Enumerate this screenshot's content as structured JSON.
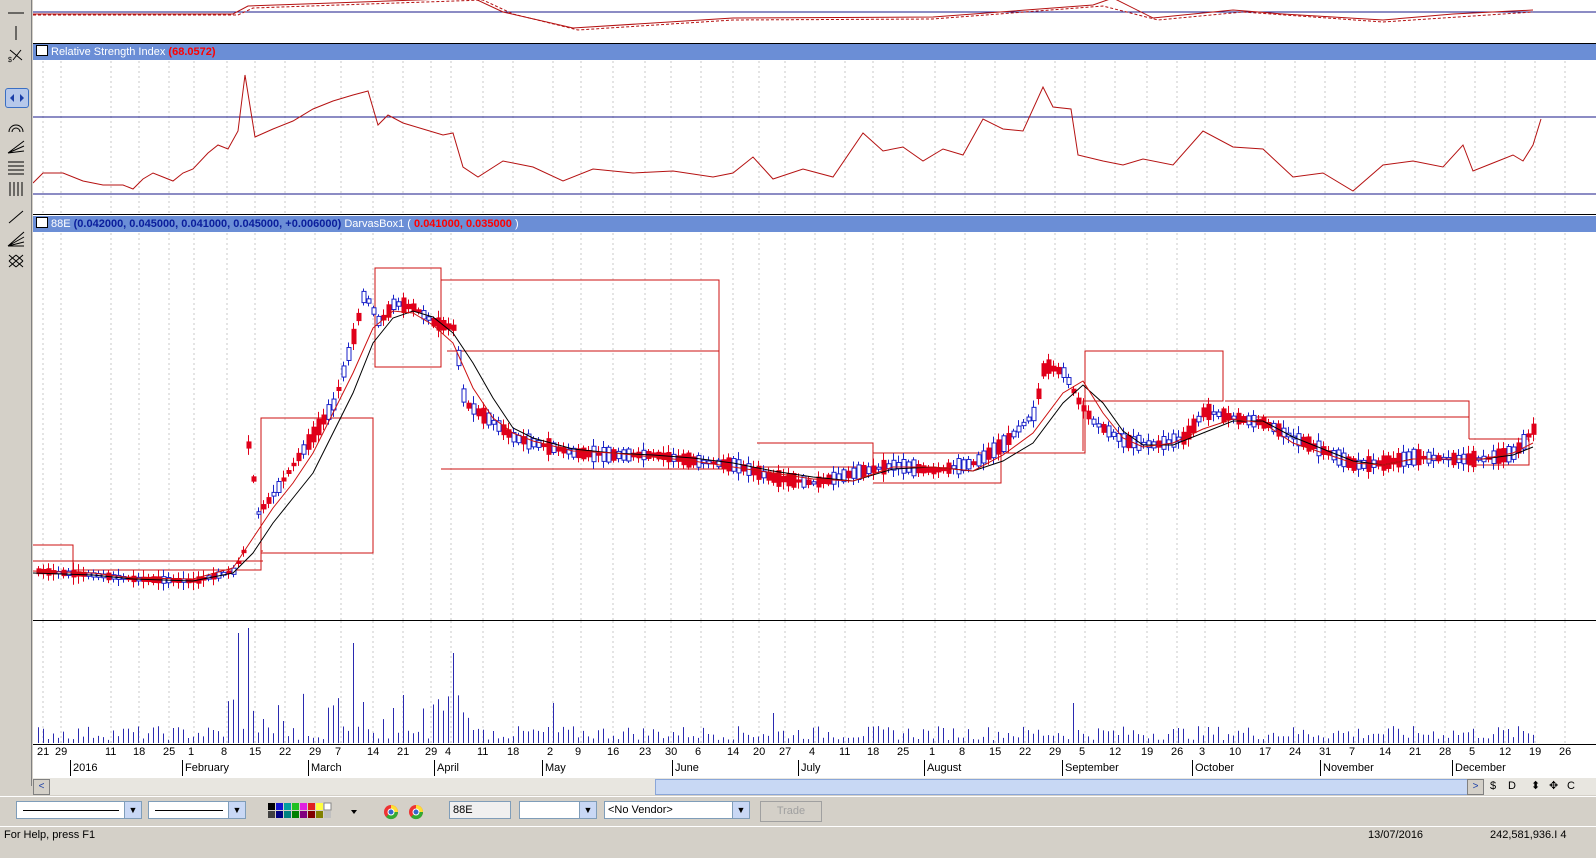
{
  "rsi_pane": {
    "title": "Relative Strength Index",
    "value": "(68.0572)"
  },
  "price_pane": {
    "symbol": "88E",
    "ohlc": "(0.042000, 0.045000, 0.041000, 0.045000, +0.006000)",
    "indicator": "DarvasBox1",
    "indicator_values": "0.041000, 0.035000"
  },
  "x_axis": {
    "days": [
      "21",
      "29",
      "11",
      "18",
      "25",
      "1",
      "8",
      "15",
      "22",
      "29",
      "7",
      "14",
      "21",
      "29",
      "4",
      "11",
      "18",
      "2",
      "9",
      "16",
      "23",
      "30",
      "6",
      "14",
      "20",
      "27",
      "4",
      "11",
      "18",
      "25",
      "1",
      "8",
      "15",
      "22",
      "29",
      "5",
      "12",
      "19",
      "26",
      "3",
      "10",
      "17",
      "24",
      "31",
      "7",
      "14",
      "21",
      "28",
      "5",
      "12",
      "19",
      "26"
    ],
    "months": [
      "2016",
      "February",
      "March",
      "April",
      "May",
      "June",
      "July",
      "August",
      "September",
      "October",
      "November",
      "December"
    ]
  },
  "scrollbar": {
    "left_arrow": "<",
    "right_arrow": ">",
    "tools": [
      "$",
      "D",
      "⬍",
      "✥",
      "C"
    ]
  },
  "bottom_toolbar": {
    "symbol_field": "88E",
    "vendor": "<No Vendor>",
    "trade_button": "Trade"
  },
  "status_bar": {
    "help": "For Help, press F1",
    "date": "13/07/2016",
    "number": "242,581,936.I 4"
  },
  "colors": {
    "candle_up": "#1a22c8",
    "candle_down": "#e0001a",
    "box": "#cc1010",
    "title_bar": "#6b8ed6"
  }
}
